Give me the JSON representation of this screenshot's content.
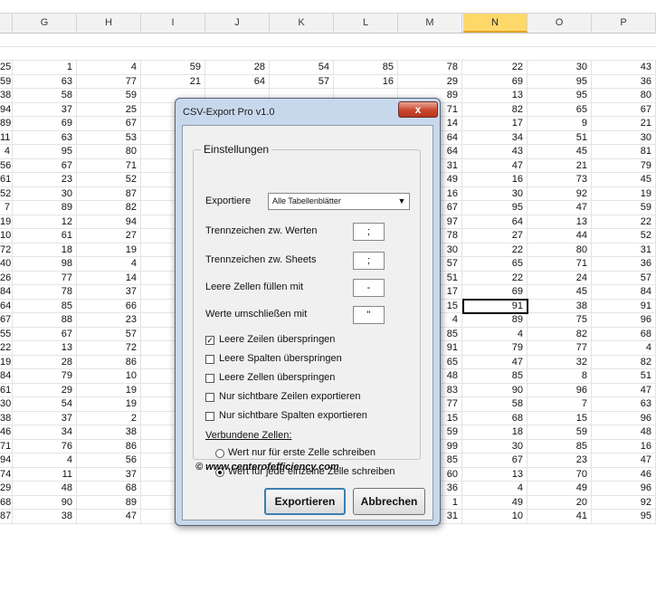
{
  "sheet": {
    "columns": [
      "G",
      "H",
      "I",
      "J",
      "K",
      "L",
      "M",
      "N",
      "O",
      "P"
    ],
    "active_column": "N",
    "partial_left": [
      "25",
      "59",
      "38",
      "94",
      "89",
      "11",
      "4",
      "56",
      "61",
      "52",
      "7",
      "19",
      "10",
      "72",
      "40",
      "26",
      "84",
      "64",
      "67",
      "55",
      "22",
      "19",
      "84",
      "61",
      "30",
      "38",
      "46",
      "71",
      "94",
      "74",
      "29",
      "68",
      "87"
    ],
    "rows": [
      [
        "1",
        "4",
        "59",
        "28",
        "54",
        "85",
        "78",
        "22",
        "30",
        "43"
      ],
      [
        "63",
        "77",
        "21",
        "64",
        "57",
        "16",
        "29",
        "69",
        "95",
        "36"
      ],
      [
        "58",
        "59",
        "",
        "",
        "",
        "",
        "89",
        "13",
        "95",
        "80"
      ],
      [
        "37",
        "25",
        "",
        "",
        "",
        "",
        "71",
        "82",
        "65",
        "67"
      ],
      [
        "69",
        "67",
        "",
        "",
        "",
        "",
        "14",
        "17",
        "9",
        "21"
      ],
      [
        "63",
        "53",
        "",
        "",
        "",
        "",
        "64",
        "34",
        "51",
        "30"
      ],
      [
        "95",
        "80",
        "",
        "",
        "",
        "",
        "64",
        "43",
        "45",
        "81"
      ],
      [
        "67",
        "71",
        "",
        "",
        "",
        "",
        "31",
        "47",
        "21",
        "79"
      ],
      [
        "23",
        "52",
        "",
        "",
        "",
        "",
        "49",
        "16",
        "73",
        "45"
      ],
      [
        "30",
        "87",
        "",
        "",
        "",
        "",
        "16",
        "30",
        "92",
        "19"
      ],
      [
        "89",
        "82",
        "",
        "",
        "",
        "",
        "67",
        "95",
        "47",
        "59"
      ],
      [
        "12",
        "94",
        "",
        "",
        "",
        "",
        "97",
        "64",
        "13",
        "22"
      ],
      [
        "61",
        "27",
        "",
        "",
        "",
        "",
        "78",
        "27",
        "44",
        "52"
      ],
      [
        "18",
        "19",
        "",
        "",
        "",
        "",
        "30",
        "22",
        "80",
        "31"
      ],
      [
        "98",
        "4",
        "",
        "",
        "",
        "",
        "57",
        "65",
        "71",
        "36"
      ],
      [
        "77",
        "14",
        "",
        "",
        "",
        "",
        "51",
        "22",
        "24",
        "57"
      ],
      [
        "78",
        "37",
        "",
        "",
        "",
        "",
        "17",
        "69",
        "45",
        "84"
      ],
      [
        "85",
        "66",
        "",
        "",
        "",
        "",
        "15",
        "91",
        "38",
        "91"
      ],
      [
        "88",
        "23",
        "",
        "",
        "",
        "",
        "4",
        "89",
        "75",
        "96"
      ],
      [
        "67",
        "57",
        "",
        "",
        "",
        "",
        "85",
        "4",
        "82",
        "68"
      ],
      [
        "13",
        "72",
        "",
        "",
        "",
        "",
        "91",
        "79",
        "77",
        "4"
      ],
      [
        "28",
        "86",
        "",
        "",
        "",
        "",
        "65",
        "47",
        "32",
        "82"
      ],
      [
        "79",
        "10",
        "",
        "",
        "",
        "",
        "48",
        "85",
        "8",
        "51"
      ],
      [
        "29",
        "19",
        "",
        "",
        "",
        "",
        "83",
        "90",
        "96",
        "47"
      ],
      [
        "54",
        "19",
        "",
        "",
        "",
        "",
        "77",
        "58",
        "7",
        "63"
      ],
      [
        "37",
        "2",
        "",
        "",
        "",
        "",
        "15",
        "68",
        "15",
        "96"
      ],
      [
        "34",
        "38",
        "",
        "",
        "",
        "",
        "59",
        "18",
        "59",
        "48"
      ],
      [
        "76",
        "86",
        "",
        "",
        "",
        "",
        "99",
        "30",
        "85",
        "16"
      ],
      [
        "4",
        "56",
        "",
        "",
        "",
        "",
        "85",
        "67",
        "23",
        "47"
      ],
      [
        "11",
        "37",
        "52",
        "39",
        "75",
        "2",
        "60",
        "13",
        "70",
        "46"
      ],
      [
        "48",
        "68",
        "60",
        "23",
        "53",
        "26",
        "36",
        "4",
        "49",
        "96"
      ],
      [
        "90",
        "89",
        "60",
        "89",
        "99",
        "66",
        "1",
        "49",
        "20",
        "92"
      ],
      [
        "38",
        "47",
        "67",
        "23",
        "91",
        "93",
        "31",
        "10",
        "41",
        "95"
      ]
    ]
  },
  "dialog": {
    "title": "CSV-Export Pro v1.0",
    "close_label": "x",
    "group_title": "Einstellungen",
    "export_label": "Exportiere",
    "export_value": "Alle Tabellenblätter",
    "sep_values_label": "Trennzeichen zw. Werten",
    "sep_values_value": ";",
    "sep_sheets_label": "Trennzeichen  zw. Sheets",
    "sep_sheets_value": ";",
    "fill_empty_label": "Leere Zellen füllen mit",
    "fill_empty_value": "-",
    "enclose_label": "Werte umschließen mit",
    "enclose_value": "\"",
    "checkboxes": [
      {
        "label": "Leere Zeilen überspringen",
        "checked": true
      },
      {
        "label": "Leere Spalten überspringen",
        "checked": false
      },
      {
        "label": "Leere Zellen überspringen",
        "checked": false
      },
      {
        "label": "Nur sichtbare Zeilen exportieren",
        "checked": false
      },
      {
        "label": "Nur sichtbare Spalten exportieren",
        "checked": false
      }
    ],
    "merged_label": "Verbundene Zellen:",
    "radios": [
      {
        "label": "Wert nur für erste Zelle schreiben",
        "selected": false
      },
      {
        "label": "Wert für jede einzelne Zelle schreiben",
        "selected": true
      }
    ],
    "url": "© www.centerofefficiency.com",
    "export_button": "Exportieren",
    "cancel_button": "Abbrechen"
  }
}
